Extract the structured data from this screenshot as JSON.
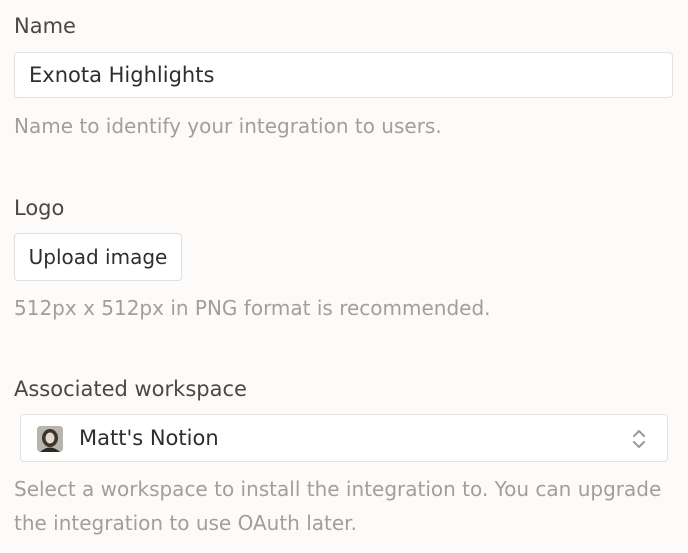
{
  "name_field": {
    "label": "Name",
    "value": "Exnota Highlights",
    "help": "Name to identify your integration to users."
  },
  "logo_field": {
    "label": "Logo",
    "button_label": "Upload image",
    "help": "512px x 512px in PNG format is recommended."
  },
  "workspace_field": {
    "label": "Associated workspace",
    "selected": "Matt's Notion",
    "help": "Select a workspace to install the integration to. You can upgrade the integration to use OAuth later."
  },
  "icons": {
    "workspace_avatar": "avatar-icon",
    "dropdown": "chevron-up-down-icon"
  }
}
